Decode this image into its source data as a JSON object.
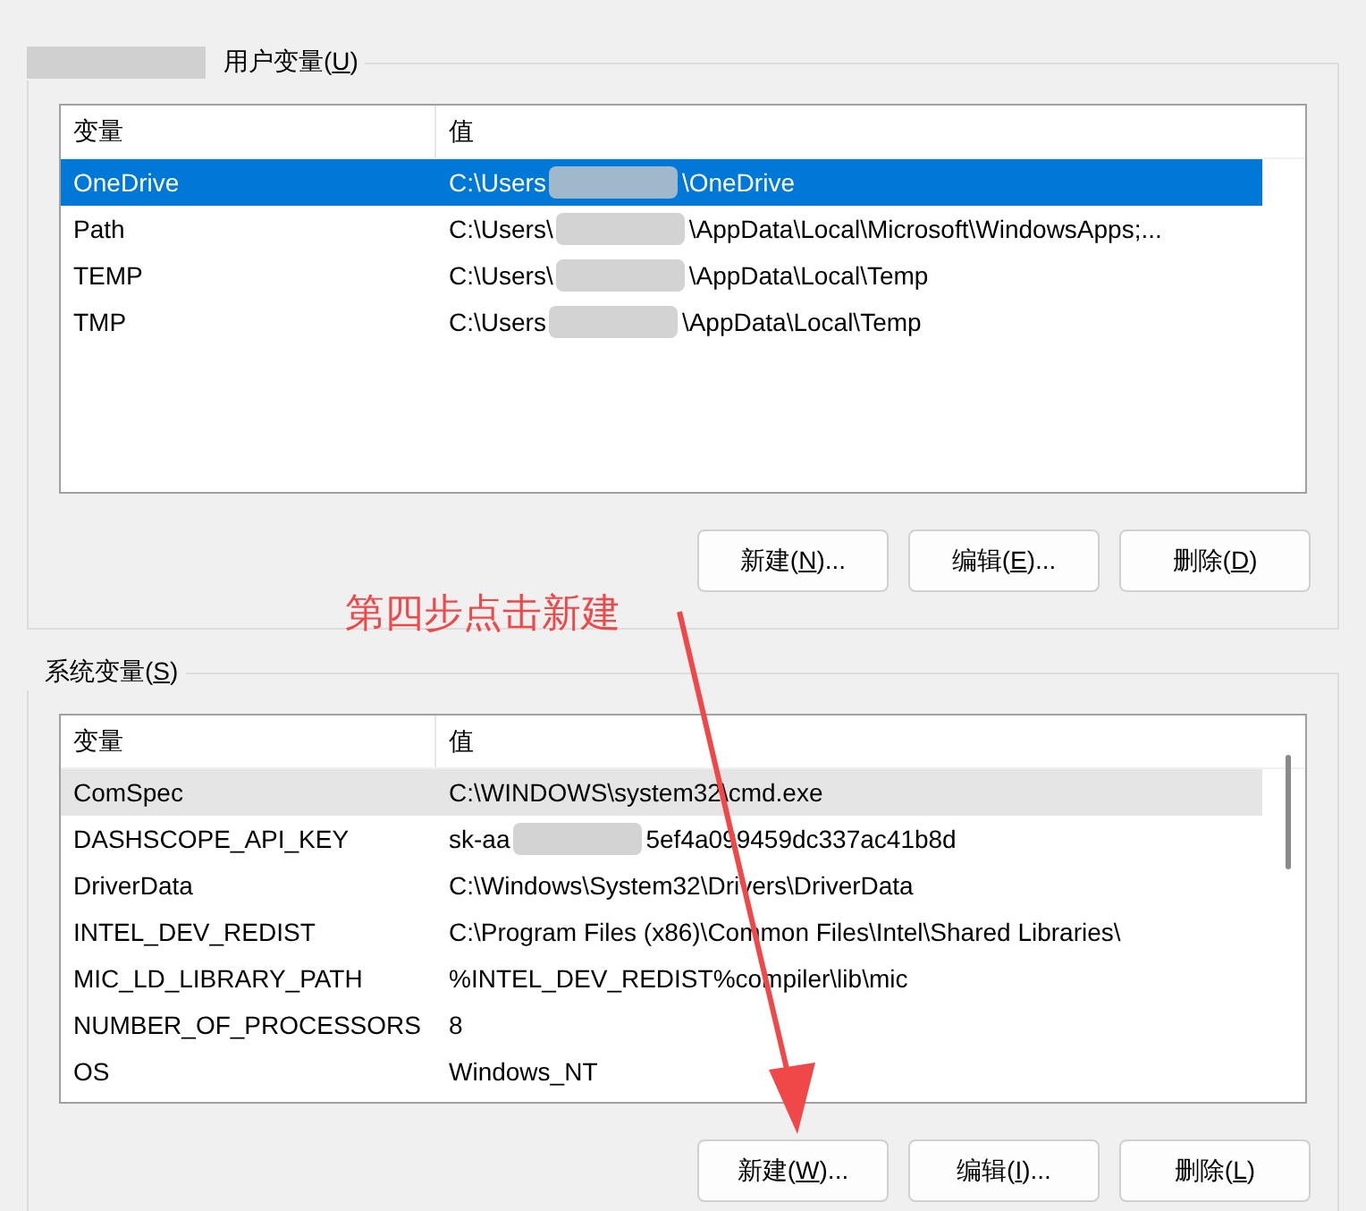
{
  "user_group": {
    "label_before": "用户变量(",
    "mnemonic": "U",
    "label_after": ")",
    "redacted_prefix": true,
    "list": {
      "focused": true,
      "columns": [
        "变量",
        "值"
      ],
      "rows": [
        {
          "name": "OneDrive",
          "value": [
            "C:\\Users",
            "\\OneDrive"
          ],
          "selected": true
        },
        {
          "name": "Path",
          "value": [
            "C:\\Users\\",
            "\\AppData\\Local\\Microsoft\\WindowsApps;..."
          ],
          "selected": false
        },
        {
          "name": "TEMP",
          "value": [
            "C:\\Users\\",
            "\\AppData\\Local\\Temp"
          ],
          "selected": false
        },
        {
          "name": "TMP",
          "value": [
            "C:\\Users",
            "\\AppData\\Local\\Temp"
          ],
          "selected": false
        }
      ]
    },
    "buttons": [
      {
        "before": "新建(",
        "mnemonic": "N",
        "after": ")..."
      },
      {
        "before": "编辑(",
        "mnemonic": "E",
        "after": ")..."
      },
      {
        "before": "删除(",
        "mnemonic": "D",
        "after": ")"
      }
    ]
  },
  "annotation": {
    "text": "第四步点击新建"
  },
  "system_group": {
    "label_before": "系统变量(",
    "mnemonic": "S",
    "label_after": ")",
    "redacted_prefix": false,
    "list": {
      "focused": false,
      "columns": [
        "变量",
        "值"
      ],
      "rows": [
        {
          "name": "ComSpec",
          "value": [
            "C:\\WINDOWS\\system32\\cmd.exe"
          ],
          "selected": true
        },
        {
          "name": "DASHSCOPE_API_KEY",
          "value": [
            "sk-aa",
            "5ef4a099459dc337ac41b8d"
          ],
          "selected": false
        },
        {
          "name": "DriverData",
          "value": [
            "C:\\Windows\\System32\\Drivers\\DriverData"
          ],
          "selected": false
        },
        {
          "name": "INTEL_DEV_REDIST",
          "value": [
            "C:\\Program Files (x86)\\Common Files\\Intel\\Shared Libraries\\"
          ],
          "selected": false
        },
        {
          "name": "MIC_LD_LIBRARY_PATH",
          "value": [
            "%INTEL_DEV_REDIST%compiler\\lib\\mic"
          ],
          "selected": false
        },
        {
          "name": "NUMBER_OF_PROCESSORS",
          "value": [
            "8"
          ],
          "selected": false
        },
        {
          "name": "OS",
          "value": [
            "Windows_NT"
          ],
          "selected": false
        }
      ]
    },
    "buttons": [
      {
        "before": "新建(",
        "mnemonic": "W",
        "after": ")..."
      },
      {
        "before": "编辑(",
        "mnemonic": "I",
        "after": ")..."
      },
      {
        "before": "删除(",
        "mnemonic": "L",
        "after": ")"
      }
    ]
  }
}
